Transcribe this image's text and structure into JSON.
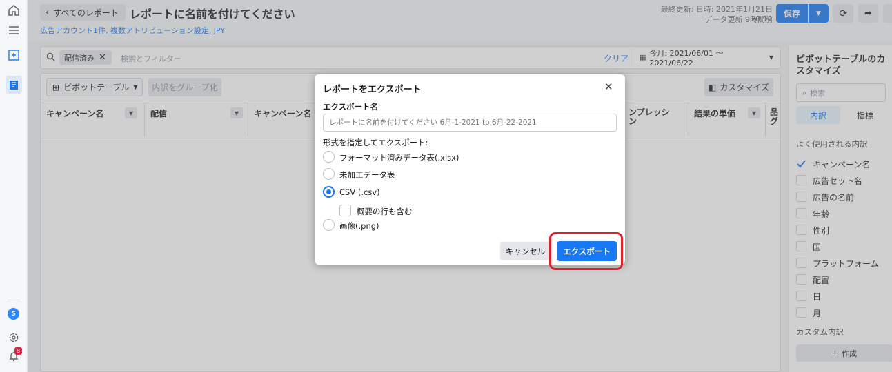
{
  "topbar": {
    "back_label": "すべてのレポート",
    "report_title": "レポートに名前を付けてください",
    "subtitle": "広告アカウント1件, 複数アトリビューション設定, JPY",
    "last_updated": "最終更新: 日時: 2021年1月21日 20:12",
    "data_updated": "データ更新 9時間前",
    "save_label": "保存"
  },
  "filter": {
    "chip_label": "配信済み",
    "placeholder": "検索とフィルター",
    "clear_label": "クリア",
    "date_range": "今月: 2021/06/01 ～ 2021/06/22"
  },
  "toolbar": {
    "pivot_label": "ピボットテーブル",
    "group_label": "内訳をグループ化",
    "customize_label": "カスタマイズ"
  },
  "columns": [
    "キャンペーン名",
    "配信",
    "キャンペーン名",
    "ンプレッシ",
    "ン",
    "結果の単価",
    "品",
    "グ"
  ],
  "right_panel": {
    "title_line1": "ピボットテーブルのカ",
    "title_line2": "スタマイズ",
    "search_placeholder": "検索",
    "tab_breakdown": "内訳",
    "tab_metrics": "指標",
    "section_common": "よく使用される内訳",
    "items": [
      "キャンペーン名",
      "広告セット名",
      "広告の名前",
      "年齢",
      "性別",
      "国",
      "プラットフォーム",
      "配置",
      "日",
      "月"
    ],
    "section_custom": "カスタム内訳",
    "create_label": "作成"
  },
  "rail": {
    "badge_count": "8",
    "avatar_letter": "S"
  },
  "modal": {
    "title": "レポートをエクスポート",
    "name_label": "エクスポート名",
    "name_placeholder": "レポートに名前を付けてください 6月-1-2021 to 6月-22-2021",
    "format_label": "形式を指定してエクスポート:",
    "options": [
      "フォーマット済みデータ表(.xlsx)",
      "未加工データ表",
      "CSV (.csv)",
      "画像(.png)"
    ],
    "selected_option": "CSV (.csv)",
    "summary_label": "概要の行も含む",
    "cancel_label": "キャンセル",
    "export_label": "エクスポート"
  },
  "colors": {
    "accent": "#1877f2",
    "highlight": "#e0202a"
  }
}
